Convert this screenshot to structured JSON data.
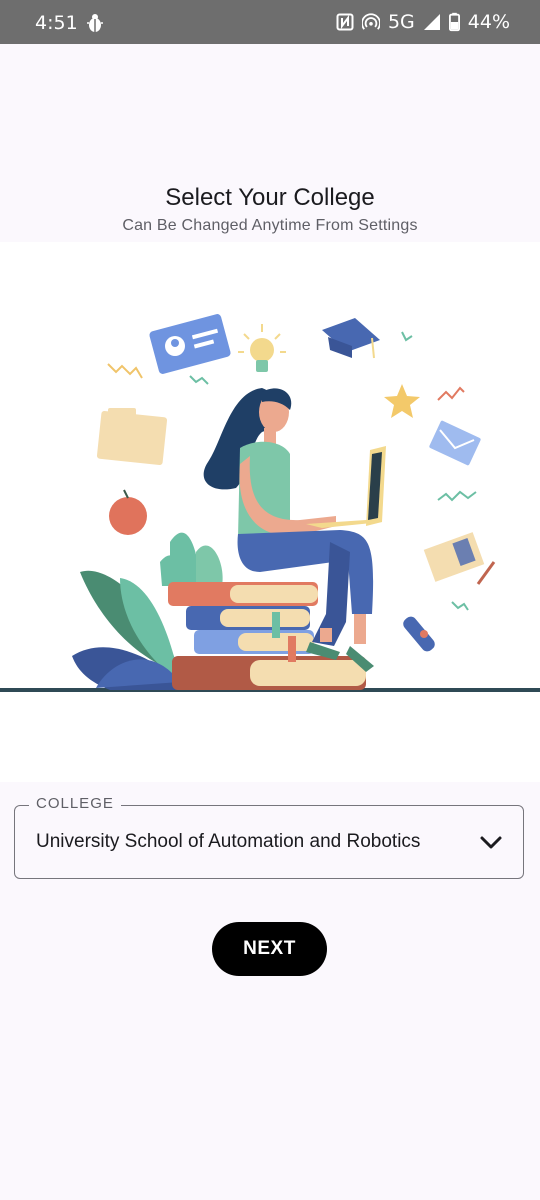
{
  "status_bar": {
    "time": "4:51",
    "network": "5G",
    "battery": "44%",
    "icons": [
      "bug-icon",
      "nfc-icon",
      "hotspot-icon",
      "signal-icon",
      "battery-icon"
    ]
  },
  "header": {
    "title": "Select Your College",
    "subtitle": "Can Be Changed Anytime From Settings"
  },
  "illustration": {
    "name": "woman-reading-on-books-illustration"
  },
  "college_field": {
    "label": "COLLEGE",
    "value": "University School of Automation and Robotics",
    "icon": "chevron-down-icon"
  },
  "next_button": {
    "label": "NEXT"
  },
  "colors": {
    "status_bar_bg": "#6e6e6e",
    "page_bg": "#fbf8fd",
    "button_bg": "#000000",
    "accent_blue": "#4f6fb5",
    "accent_teal": "#6cbfa4"
  }
}
